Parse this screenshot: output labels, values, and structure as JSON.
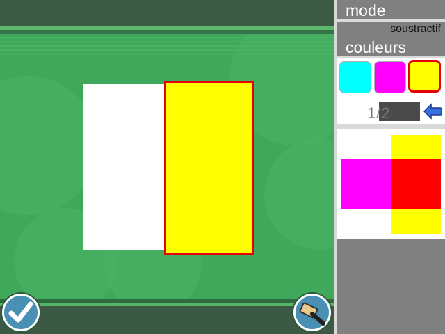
{
  "panel": {
    "mode_label": "mode",
    "mode_value": "soustractif",
    "colors_label": "couleurs",
    "swatches": [
      {
        "name": "cyan",
        "color": "#00ffff",
        "selected": false
      },
      {
        "name": "magenta",
        "color": "#ff00ff",
        "selected": false
      },
      {
        "name": "yellow",
        "color": "#ffff00",
        "selected": true
      }
    ],
    "page_counter": "1/2",
    "back_icon": "back-arrow-icon"
  },
  "board": {
    "cards": [
      {
        "name": "white",
        "color": "#ffffff"
      },
      {
        "name": "yellow",
        "color": "#ffff00",
        "selected": true
      }
    ]
  },
  "preview": {
    "colors": {
      "yellow": "#ffff00",
      "magenta": "#ff00ff",
      "red": "#ff0000",
      "white": "#ffffff"
    }
  },
  "buttons": {
    "validate_icon": "checkmark-icon",
    "reset_icon": "hammer-icon"
  },
  "colors": {
    "selection_border": "#e60000",
    "board_green": "#3fa85a",
    "panel_gray": "#808080"
  }
}
